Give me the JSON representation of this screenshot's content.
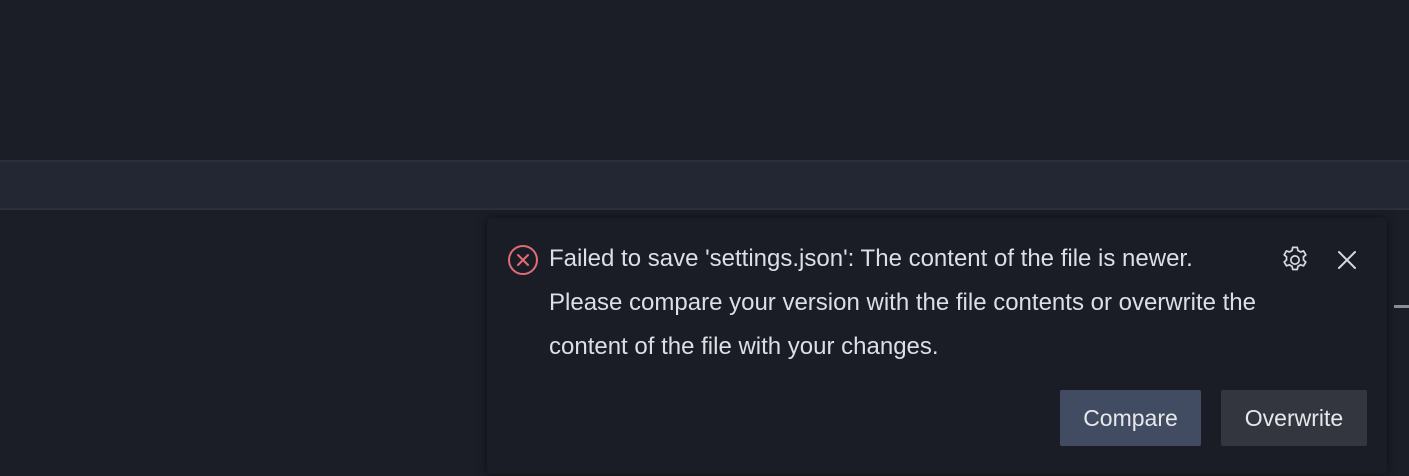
{
  "notification": {
    "severity": "error",
    "icon": "error-circle-icon",
    "message": "Failed to save 'settings.json': The content of the file is newer. Please compare your version with the file contents or overwrite the content of the file with your changes.",
    "actions": {
      "compare_label": "Compare",
      "overwrite_label": "Overwrite"
    },
    "settings_icon": "gear-icon",
    "close_icon": "close-icon"
  },
  "colors": {
    "error": "#e06c75",
    "background": "#1b1e27",
    "toast_background": "#1a1d25",
    "primary_button": "#414b61",
    "secondary_button": "#33363e",
    "text": "#dcdfe5"
  }
}
